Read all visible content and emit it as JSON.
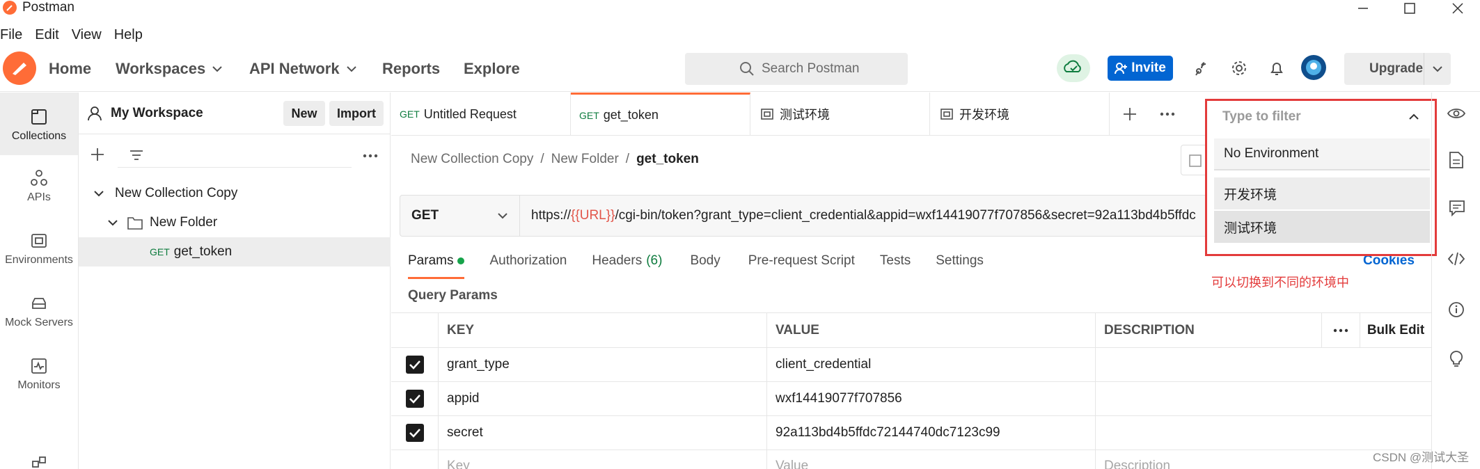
{
  "window": {
    "title": "Postman"
  },
  "menu": [
    "File",
    "Edit",
    "View",
    "Help"
  ],
  "header": {
    "nav": [
      "Home",
      "Workspaces",
      "API Network",
      "Reports",
      "Explore"
    ],
    "search_placeholder": "Search Postman",
    "invite": "Invite",
    "upgrade": "Upgrade"
  },
  "workspace": {
    "name": "My Workspace",
    "new": "New",
    "import": "Import"
  },
  "rail": [
    "Collections",
    "APIs",
    "Environments",
    "Mock Servers",
    "Monitors"
  ],
  "tree": {
    "collection": "New Collection Copy",
    "folder": "New Folder",
    "request_method": "GET",
    "request": "get_token"
  },
  "tabs": [
    {
      "method": "GET",
      "label": "Untitled Request"
    },
    {
      "method": "GET",
      "label": "get_token"
    },
    {
      "label": "测试环境"
    },
    {
      "label": "开发环境"
    }
  ],
  "breadcrumb": {
    "part1": "New Collection Copy",
    "sep1": "/",
    "part2": "New Folder",
    "sep2": "/",
    "current": "get_token"
  },
  "request": {
    "method": "GET",
    "url_prefix": "https://",
    "url_var": "{{URL}}",
    "url_rest": "/cgi-bin/token?grant_type=client_credential&appid=wxf14419077f707856&secret=92a113bd4b5ffdc"
  },
  "req_tabs": {
    "params": "Params",
    "authorization": "Authorization",
    "headers": "Headers",
    "headers_count": "(6)",
    "body": "Body",
    "prerequest": "Pre-request Script",
    "tests": "Tests",
    "settings": "Settings",
    "cookies": "Cookies"
  },
  "query_params_title": "Query Params",
  "table": {
    "headers": {
      "key": "KEY",
      "value": "VALUE",
      "description": "DESCRIPTION",
      "bulk": "Bulk Edit"
    },
    "rows": [
      {
        "key": "grant_type",
        "value": "client_credential"
      },
      {
        "key": "appid",
        "value": "wxf14419077f707856"
      },
      {
        "key": "secret",
        "value": "92a113bd4b5ffdc72144740dc7123c99"
      }
    ],
    "placeholder": {
      "key": "Key",
      "value": "Value",
      "description": "Description"
    }
  },
  "env_dropdown": {
    "filter_placeholder": "Type to filter",
    "options": [
      "No Environment",
      "开发环境",
      "测试环境"
    ]
  },
  "annotation": "可以切换到不同的环境中",
  "watermark": "CSDN @测试大圣",
  "colors": {
    "brand": "#ff6c37",
    "accent": "#0265d2",
    "annotation": "#e33b3b",
    "get": "#0f7c3f"
  }
}
